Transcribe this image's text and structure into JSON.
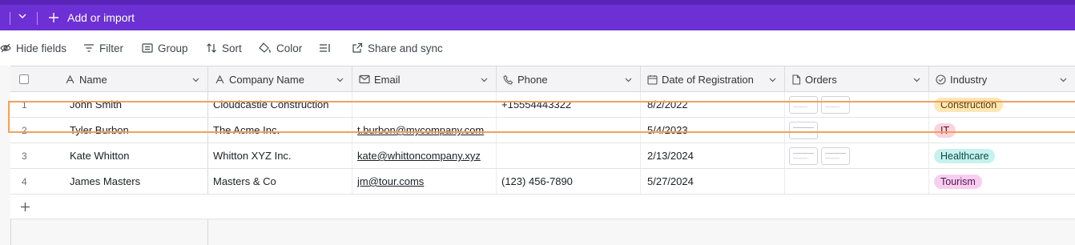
{
  "topbar": {
    "add_label": "Add or import"
  },
  "toolbar": {
    "hide_fields": "Hide fields",
    "filter": "Filter",
    "group": "Group",
    "sort": "Sort",
    "color": "Color",
    "share": "Share and sync"
  },
  "columns": {
    "name": "Name",
    "company": "Company Name",
    "email": "Email",
    "phone": "Phone",
    "date": "Date of Registration",
    "orders": "Orders",
    "industry": "Industry"
  },
  "rows": [
    {
      "num": "1",
      "name": "John Smith",
      "company": "Cloudcastle Construction",
      "email": "",
      "phone": "+15554443322",
      "date": "8/2/2022",
      "orders": 2,
      "industry": "Construction",
      "industry_bg": "#fde7b4",
      "industry_fg": "#5a3b00"
    },
    {
      "num": "2",
      "name": "Tyler Burbon",
      "company": "The Acme Inc.",
      "email": "t.burbon@mycompany.com",
      "phone": "",
      "date": "5/4/2023",
      "orders": 1,
      "industry": "IT",
      "industry_bg": "#fbd3dd",
      "industry_fg": "#5b1026"
    },
    {
      "num": "3",
      "name": "Kate Whitton",
      "company": "Whitton XYZ Inc.",
      "email": "kate@whittoncompany.xyz",
      "phone": "",
      "date": "2/13/2024",
      "orders": 2,
      "industry": "Healthcare",
      "industry_bg": "#c7f1ec",
      "industry_fg": "#0c4b45"
    },
    {
      "num": "4",
      "name": "James Masters",
      "company": "Masters & Co",
      "email": "jm@tour.coms",
      "phone": "(123) 456-7890",
      "date": "5/27/2024",
      "orders": 0,
      "industry": "Tourism",
      "industry_bg": "#f6cff0",
      "industry_fg": "#5a1152"
    }
  ],
  "colors": {
    "topbar": "#6c30d4",
    "highlight": "#f0a15f"
  }
}
